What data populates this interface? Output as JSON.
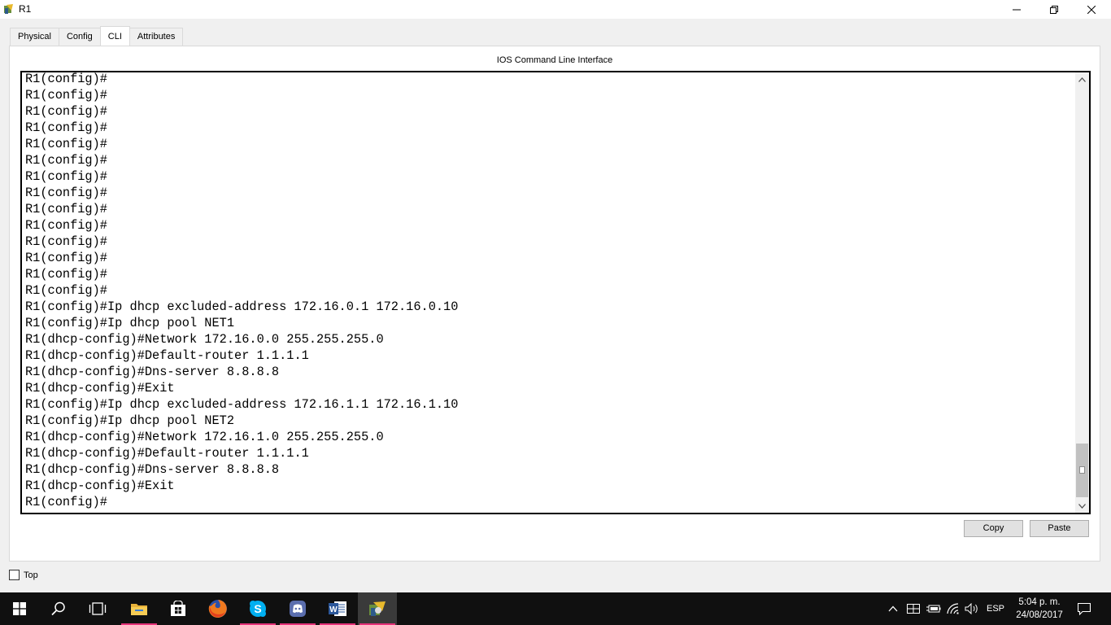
{
  "window": {
    "title": "R1",
    "minimize_icon": "minimize-icon",
    "maximize_icon": "restore-icon",
    "close_icon": "close-icon"
  },
  "tabs": [
    {
      "label": "Physical",
      "active": false
    },
    {
      "label": "Config",
      "active": false
    },
    {
      "label": "CLI",
      "active": true
    },
    {
      "label": "Attributes",
      "active": false
    }
  ],
  "panel": {
    "title": "IOS Command Line Interface",
    "terminal_lines": [
      "R1(config)#",
      "R1(config)#",
      "R1(config)#",
      "R1(config)#",
      "R1(config)#",
      "R1(config)#",
      "R1(config)#",
      "R1(config)#",
      "R1(config)#",
      "R1(config)#",
      "R1(config)#",
      "R1(config)#",
      "R1(config)#",
      "R1(config)#",
      "R1(config)#Ip dhcp excluded-address 172.16.0.1 172.16.0.10",
      "R1(config)#Ip dhcp pool NET1",
      "R1(dhcp-config)#Network 172.16.0.0 255.255.255.0",
      "R1(dhcp-config)#Default-router 1.1.1.1",
      "R1(dhcp-config)#Dns-server 8.8.8.8",
      "R1(dhcp-config)#Exit",
      "R1(config)#Ip dhcp excluded-address 172.16.1.1 172.16.1.10",
      "R1(config)#Ip dhcp pool NET2",
      "R1(dhcp-config)#Network 172.16.1.0 255.255.255.0",
      "R1(dhcp-config)#Default-router 1.1.1.1",
      "R1(dhcp-config)#Dns-server 8.8.8.8",
      "R1(dhcp-config)#Exit",
      "R1(config)#"
    ],
    "copy_label": "Copy",
    "paste_label": "Paste"
  },
  "top_checkbox": {
    "label": "Top",
    "checked": false
  },
  "taskbar": {
    "language": "ESP",
    "time": "5:04 p. m.",
    "date": "24/08/2017",
    "apps": [
      "start",
      "search",
      "task-view",
      "file-explorer",
      "store",
      "firefox",
      "skype",
      "discord",
      "word",
      "packet-tracer"
    ]
  },
  "colors": {
    "taskbar_bg": "#101010",
    "accent": "#e6337a"
  }
}
